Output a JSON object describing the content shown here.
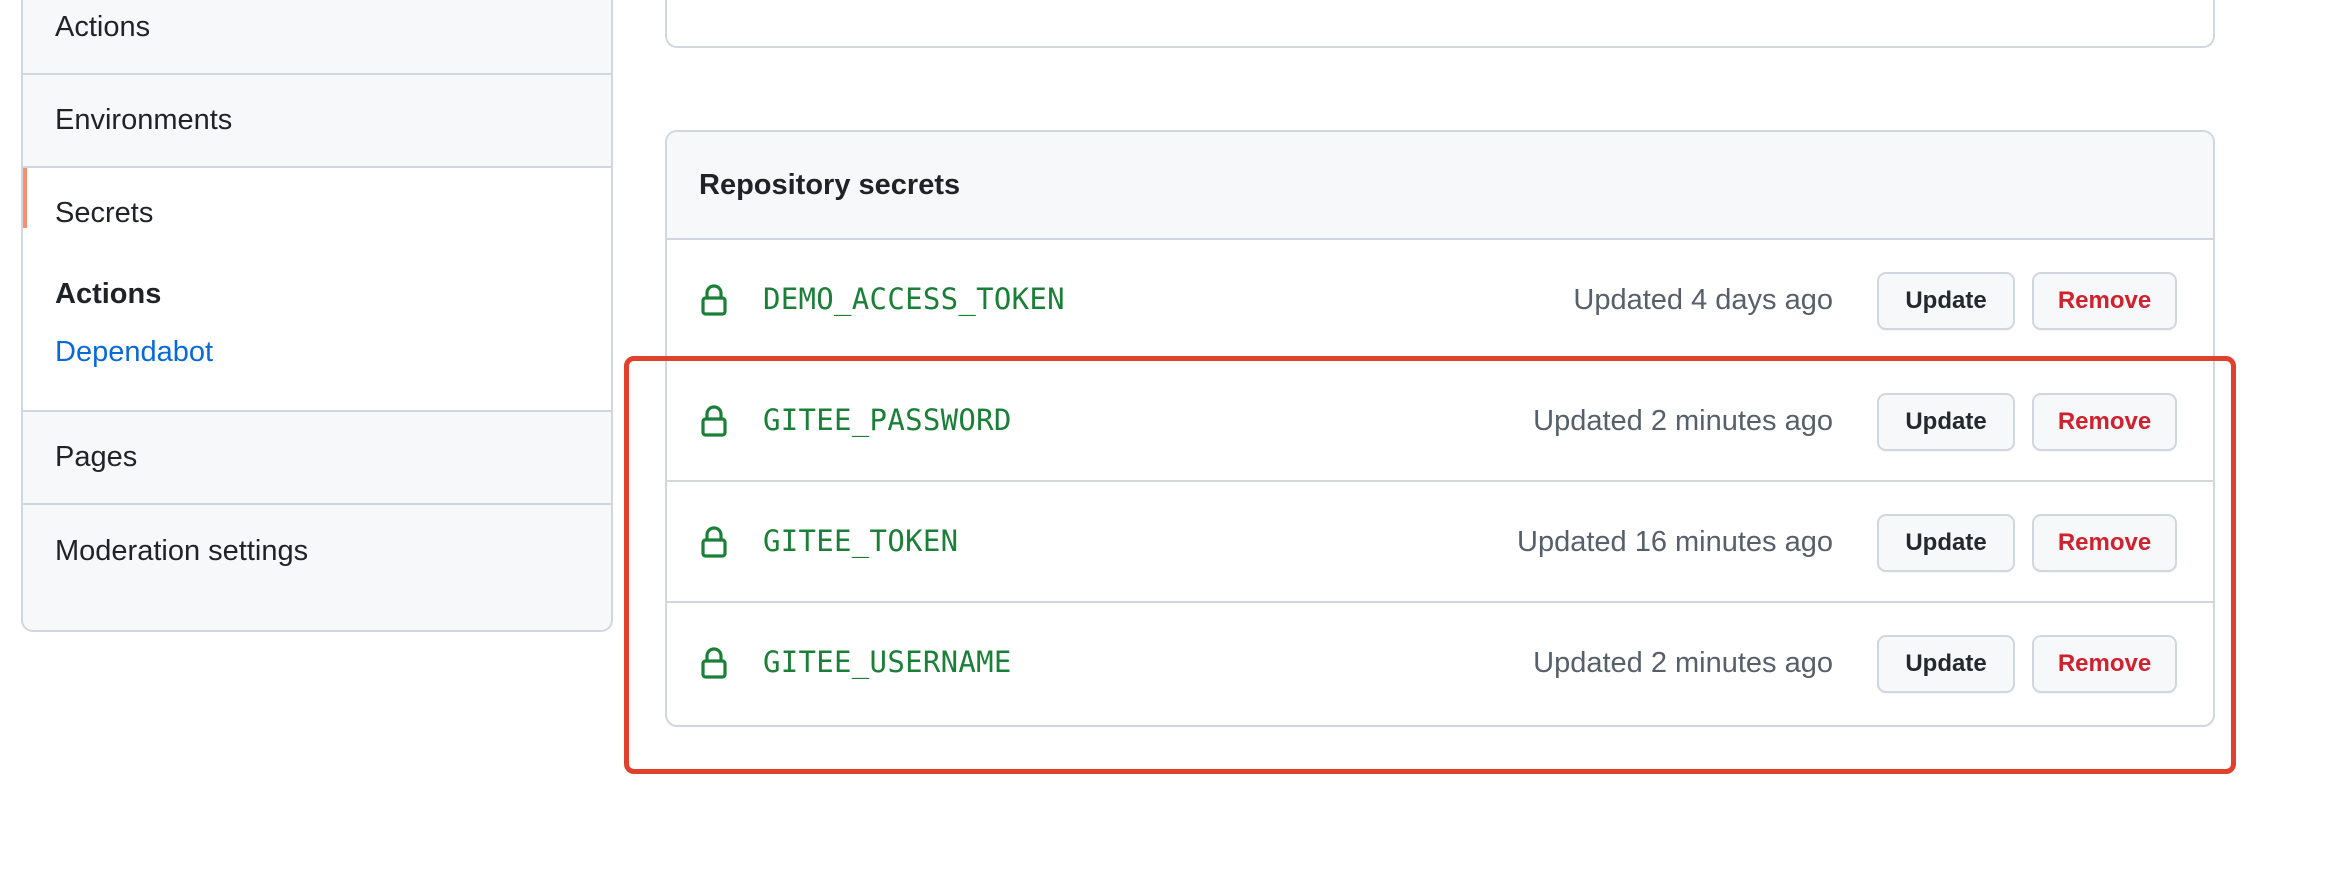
{
  "sidebar": {
    "items_top": [
      {
        "label": "Actions"
      },
      {
        "label": "Environments"
      },
      {
        "label": "Secrets",
        "active": true
      }
    ],
    "secrets_group": {
      "title": "Actions",
      "link": "Dependabot"
    },
    "items_bottom": [
      {
        "label": "Pages"
      },
      {
        "label": "Moderation settings"
      }
    ]
  },
  "secrets_panel": {
    "title": "Repository secrets",
    "rows": [
      {
        "name": "DEMO_ACCESS_TOKEN",
        "updated": "Updated 4 days ago",
        "update_label": "Update",
        "remove_label": "Remove",
        "icon": "lock-icon"
      },
      {
        "name": "GITEE_PASSWORD",
        "updated": "Updated 2 minutes ago",
        "update_label": "Update",
        "remove_label": "Remove",
        "icon": "lock-icon"
      },
      {
        "name": "GITEE_TOKEN",
        "updated": "Updated 16 minutes ago",
        "update_label": "Update",
        "remove_label": "Remove",
        "icon": "lock-icon"
      },
      {
        "name": "GITEE_USERNAME",
        "updated": "Updated 2 minutes ago",
        "update_label": "Update",
        "remove_label": "Remove",
        "icon": "lock-icon"
      }
    ]
  },
  "colors": {
    "accent_active": "#fd8c73",
    "secret_name": "#1a7f37",
    "remove_text": "#cf222e",
    "link": "#0969da",
    "highlight": "#e0412c"
  }
}
